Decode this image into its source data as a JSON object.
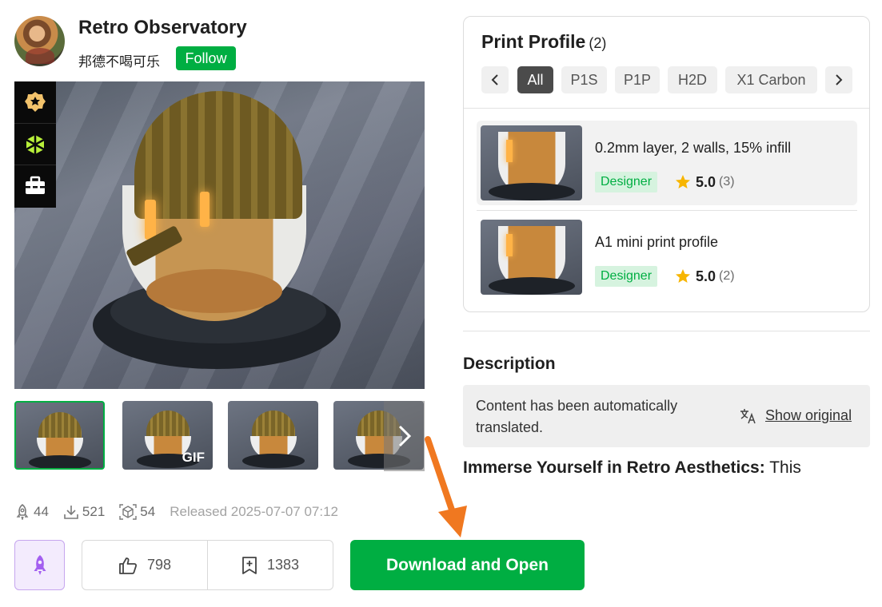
{
  "model": {
    "title": "Retro Observatory",
    "author": "邦德不喝可乐",
    "follow_label": "Follow"
  },
  "gallery": {
    "thumbnails": [
      {
        "badge": ""
      },
      {
        "badge": "GIF"
      },
      {
        "badge": ""
      },
      {
        "badge": ""
      }
    ]
  },
  "stats": {
    "boosts": "44",
    "downloads": "521",
    "prints": "54",
    "released": "Released 2025-07-07 07:12"
  },
  "actions": {
    "likes": "798",
    "collections": "1383",
    "download_label": "Download and Open"
  },
  "print_profile": {
    "title": "Print Profile",
    "count": "(2)",
    "filters": [
      "All",
      "P1S",
      "P1P",
      "H2D",
      "X1 Carbon"
    ],
    "profiles": [
      {
        "name": "0.2mm layer, 2 walls, 15% infill",
        "badge": "Designer",
        "rating": "5.0",
        "rating_count": "(3)"
      },
      {
        "name": "A1 mini print profile",
        "badge": "Designer",
        "rating": "5.0",
        "rating_count": "(2)"
      }
    ]
  },
  "description": {
    "title": "Description",
    "translated_notice": "Content has been automatically translated.",
    "show_original": "Show original",
    "lead_bold": "Immerse Yourself in Retro Aesthetics:",
    "lead_text": " This"
  },
  "colors": {
    "brand_green": "#00ae42",
    "boost_purple": "#a35ff0",
    "annotation_orange": "#f07820",
    "star_yellow": "#f7b500"
  }
}
